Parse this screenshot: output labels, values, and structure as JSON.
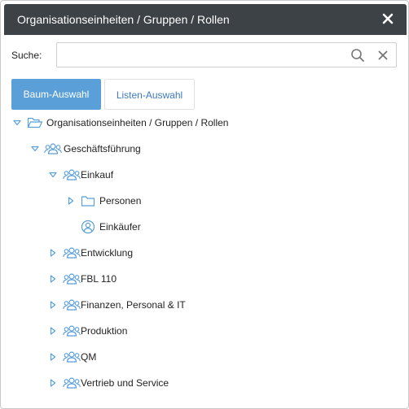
{
  "dialog": {
    "title": "Organisationseinheiten / Gruppen / Rollen"
  },
  "search": {
    "label": "Suche:",
    "value": "",
    "placeholder": ""
  },
  "tabs": [
    {
      "label": "Baum-Auswahl",
      "active": true
    },
    {
      "label": "Listen-Auswahl",
      "active": false
    }
  ],
  "colors": {
    "titlebar": "#3d4247",
    "accent": "#5a9fd8",
    "link": "#3b7bbf",
    "icon": "#5a9fd8"
  },
  "tree": [
    {
      "label": "Organisationseinheiten / Gruppen / Rollen",
      "icon": "folder-open-icon",
      "expanded": true
    },
    {
      "label": "Geschäftsführung",
      "icon": "group-icon",
      "expanded": true
    },
    {
      "label": "Einkauf",
      "icon": "group-icon",
      "expanded": true
    },
    {
      "label": "Personen",
      "icon": "folder-icon",
      "expanded": false
    },
    {
      "label": "Einkäufer",
      "icon": "user-circle-icon"
    },
    {
      "label": "Entwicklung",
      "icon": "group-icon",
      "expanded": false
    },
    {
      "label": "FBL 110",
      "icon": "group-icon",
      "expanded": false
    },
    {
      "label": "Finanzen, Personal & IT",
      "icon": "group-icon",
      "expanded": false
    },
    {
      "label": "Produktion",
      "icon": "group-icon",
      "expanded": false
    },
    {
      "label": "QM",
      "icon": "group-icon",
      "expanded": false
    },
    {
      "label": "Vertrieb und Service",
      "icon": "group-icon",
      "expanded": false
    }
  ]
}
